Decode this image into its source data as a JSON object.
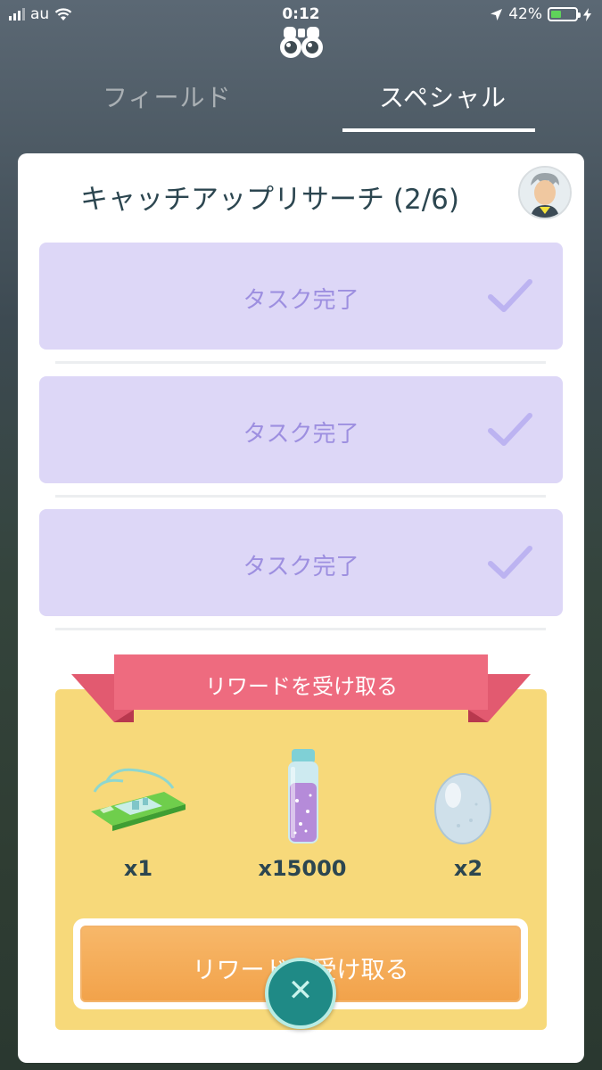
{
  "status_bar": {
    "carrier": "au",
    "time": "0:12",
    "battery_percent_text": "42%",
    "battery_level": 0.42
  },
  "tabs": [
    {
      "label": "フィールド",
      "active": false
    },
    {
      "label": "スペシャル",
      "active": true
    }
  ],
  "research": {
    "title": "キャッチアップリサーチ (2/6)",
    "tasks": [
      {
        "label": "タスク完了"
      },
      {
        "label": "タスク完了"
      },
      {
        "label": "タスク完了"
      }
    ]
  },
  "reward": {
    "banner": "リワードを受け取る",
    "items": [
      {
        "icon": "incubator-icon",
        "count": "x1"
      },
      {
        "icon": "stardust-icon",
        "count": "x15000"
      },
      {
        "icon": "egg-icon",
        "count": "x2"
      }
    ],
    "claim_button_label": "リワードを受け取る"
  },
  "close_glyph": "✕",
  "colors": {
    "task_bg": "#ddd7f7",
    "task_text": "#9d8fe0",
    "reward_bg": "#f7d97a",
    "ribbon": "#ee6b7f",
    "button": "#f2a24a",
    "close_button": "#1f8a86"
  }
}
